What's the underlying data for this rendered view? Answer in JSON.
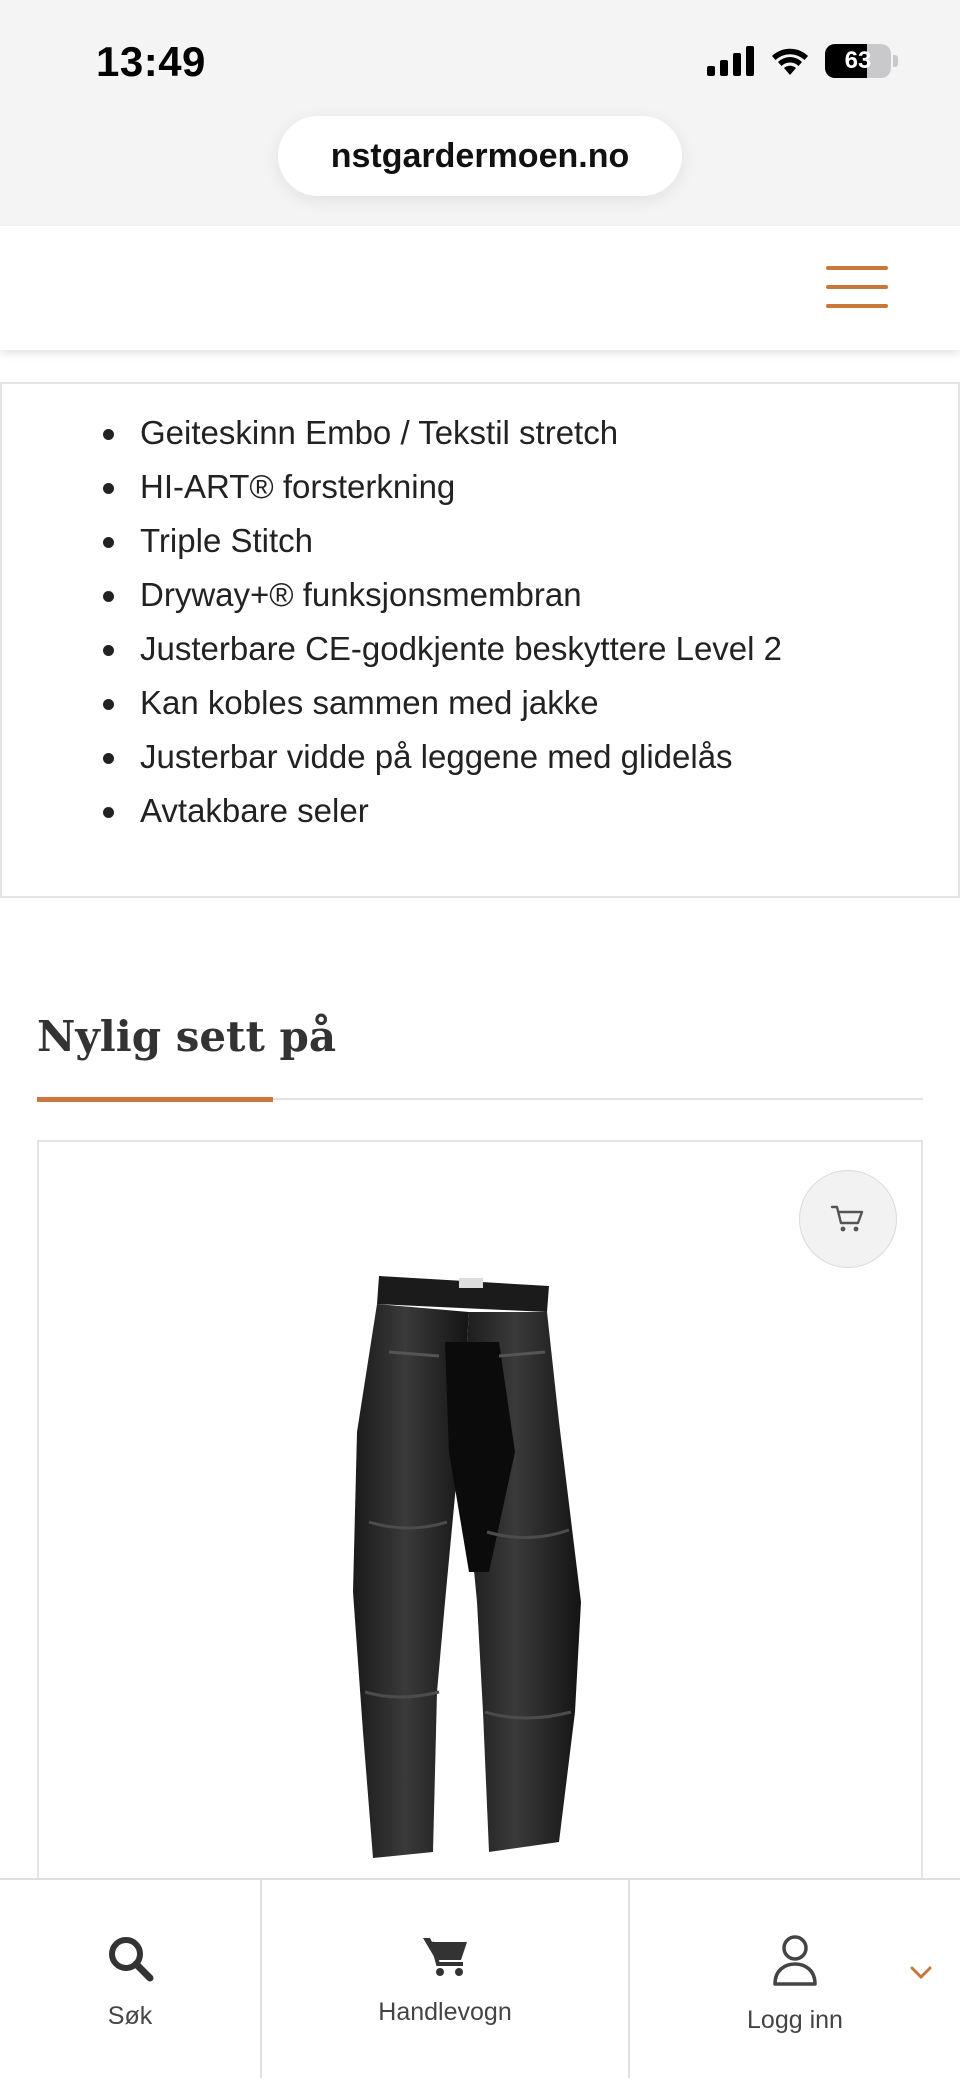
{
  "status_bar": {
    "time": "13:49",
    "battery": "63",
    "battery_fraction": 0.63
  },
  "browser": {
    "url": "nstgardermoen.no"
  },
  "header": {
    "menu_icon": "hamburger-menu-icon",
    "accent_color": "#c9773a"
  },
  "features": [
    "Geiteskinn Embo / Tekstil stretch",
    "HI-ART® forsterkning",
    "Triple Stitch",
    "Dryway+® funksjonsmembran",
    "Justerbare CE-godkjente beskyttere Level 2",
    "Kan kobles sammen med jakke",
    "Justerbar vidde på leggene med glidelås",
    "Avtakbare seler"
  ],
  "recently_viewed": {
    "title": "Nylig sett på"
  },
  "product_card": {
    "cart_icon": "add-to-cart-icon",
    "image_alt": "black-leather-motorcycle-pants"
  },
  "bottom_nav": {
    "items": [
      {
        "label": "Søk",
        "icon": "search-icon"
      },
      {
        "label": "Handlevogn",
        "icon": "cart-icon"
      },
      {
        "label": "Logg inn",
        "icon": "user-icon"
      }
    ]
  }
}
